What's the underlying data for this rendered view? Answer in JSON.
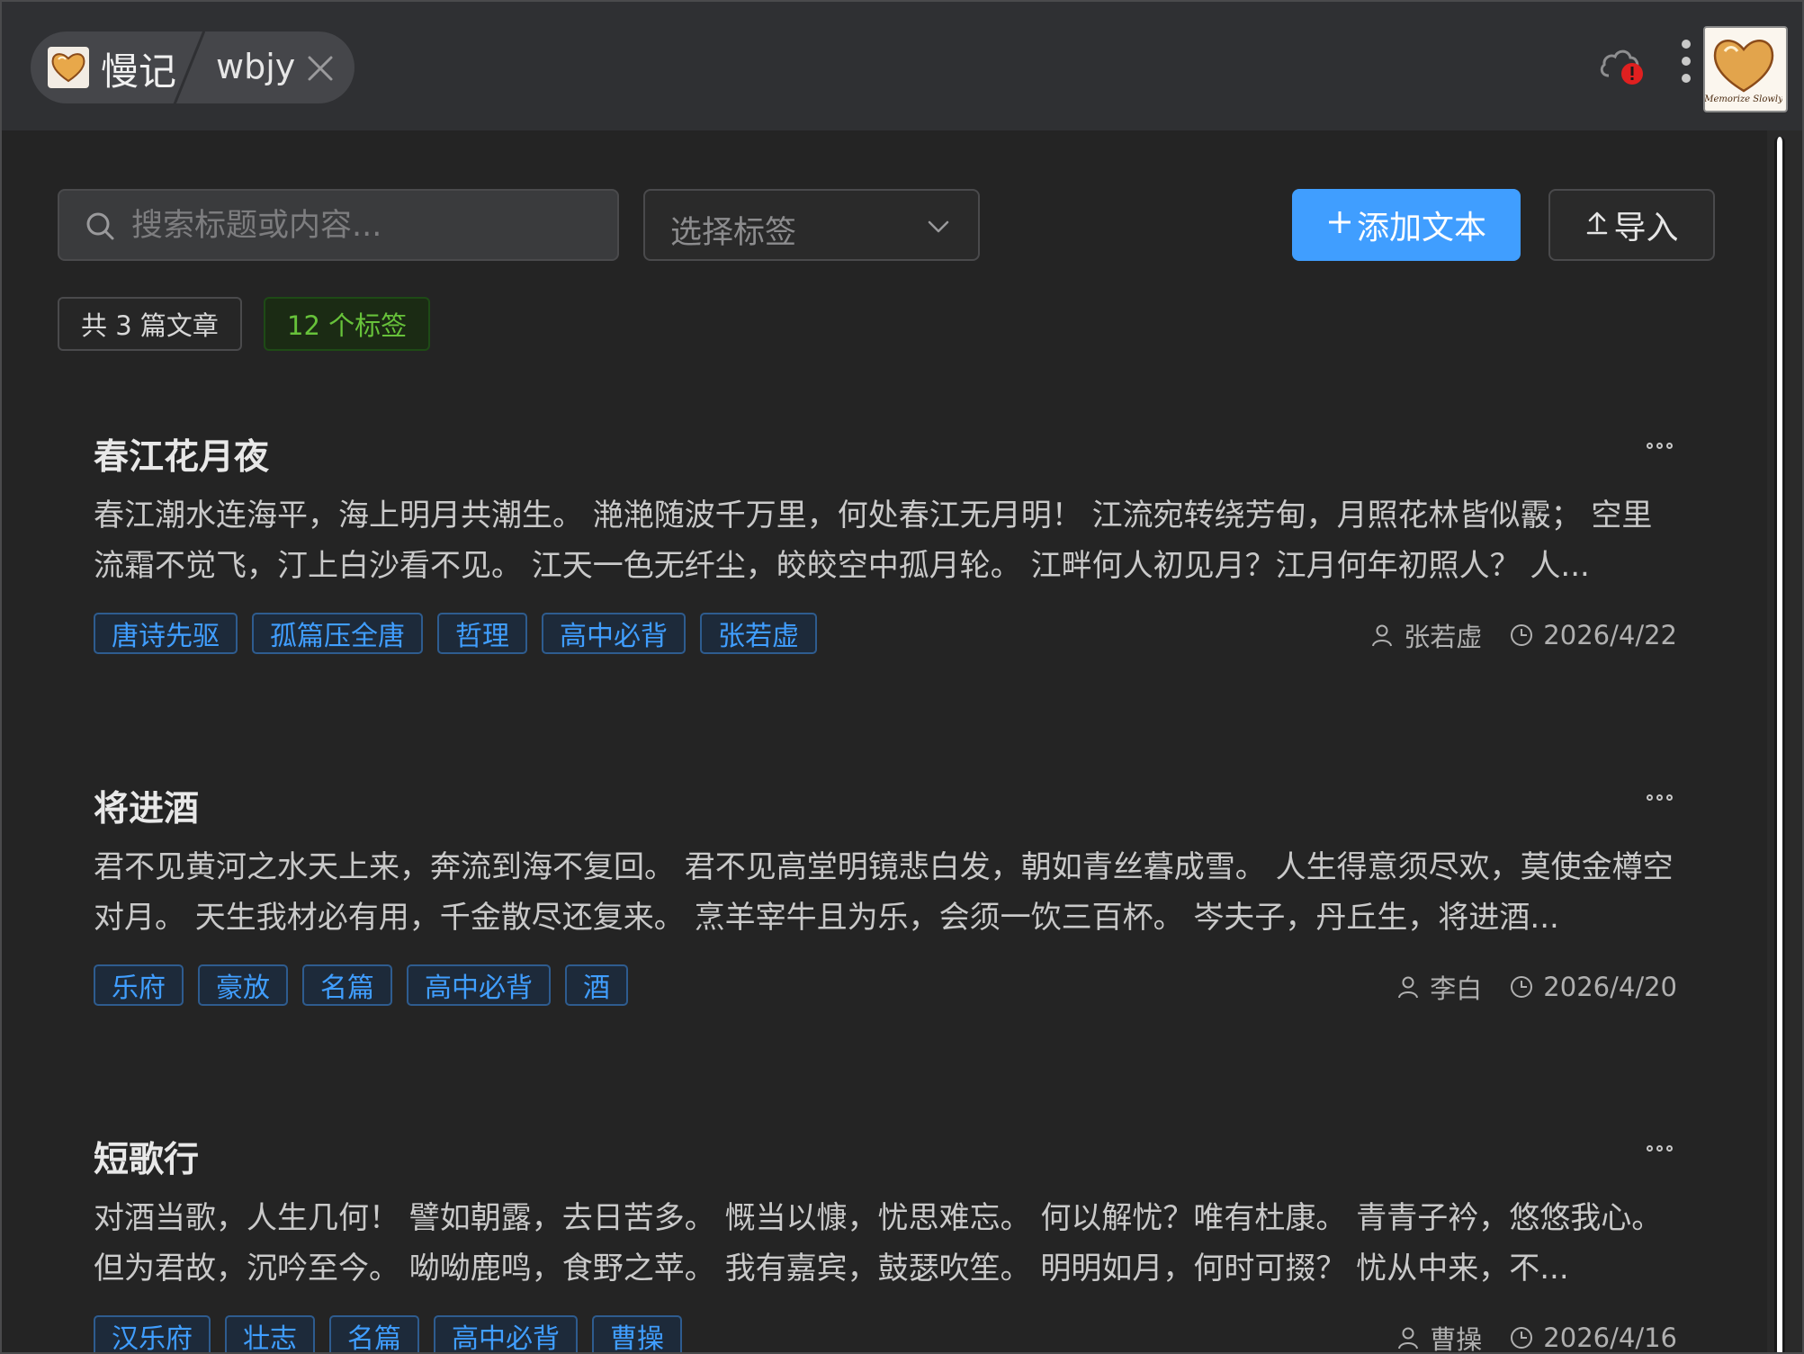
{
  "window": {
    "app_name": "慢记",
    "tab_label": "wbjy",
    "logo_text": "Memorize Slowly"
  },
  "toolbar": {
    "search_placeholder": "搜索标题或内容...",
    "tag_select_label": "选择标签",
    "add_label": "添加文本",
    "import_label": "导入"
  },
  "stats": {
    "articles": "共 3 篇文章",
    "tags": "12 个标签"
  },
  "colors": {
    "accent": "#409eff",
    "success": "#67c23a",
    "sync_error": "#e02020"
  },
  "articles": [
    {
      "title": "春江花月夜",
      "content": "春江潮水连海平，海上明月共潮生。 滟滟随波千万里，何处春江无月明！ 江流宛转绕芳甸，月照花林皆似霰； 空里流霜不觉飞，汀上白沙看不见。 江天一色无纤尘，皎皎空中孤月轮。 江畔何人初见月？江月何年初照人？ 人...",
      "tags": [
        "唐诗先驱",
        "孤篇压全唐",
        "哲理",
        "高中必背",
        "张若虚"
      ],
      "author": "张若虚",
      "date": "2026/4/22"
    },
    {
      "title": "将进酒",
      "content": "君不见黄河之水天上来，奔流到海不复回。 君不见高堂明镜悲白发，朝如青丝暮成雪。 人生得意须尽欢，莫使金樽空对月。 天生我材必有用，千金散尽还复来。 烹羊宰牛且为乐，会须一饮三百杯。 岑夫子，丹丘生，将进酒...",
      "tags": [
        "乐府",
        "豪放",
        "名篇",
        "高中必背",
        "酒"
      ],
      "author": "李白",
      "date": "2026/4/20"
    },
    {
      "title": "短歌行",
      "content": "对酒当歌，人生几何！ 譬如朝露，去日苦多。 慨当以慷，忧思难忘。 何以解忧？唯有杜康。 青青子衿，悠悠我心。 但为君故，沉吟至今。 呦呦鹿鸣，食野之苹。 我有嘉宾，鼓瑟吹笙。 明明如月，何时可掇？ 忧从中来，不...",
      "tags": [
        "汉乐府",
        "壮志",
        "名篇",
        "高中必背",
        "曹操"
      ],
      "author": "曹操",
      "date": "2026/4/16"
    }
  ]
}
